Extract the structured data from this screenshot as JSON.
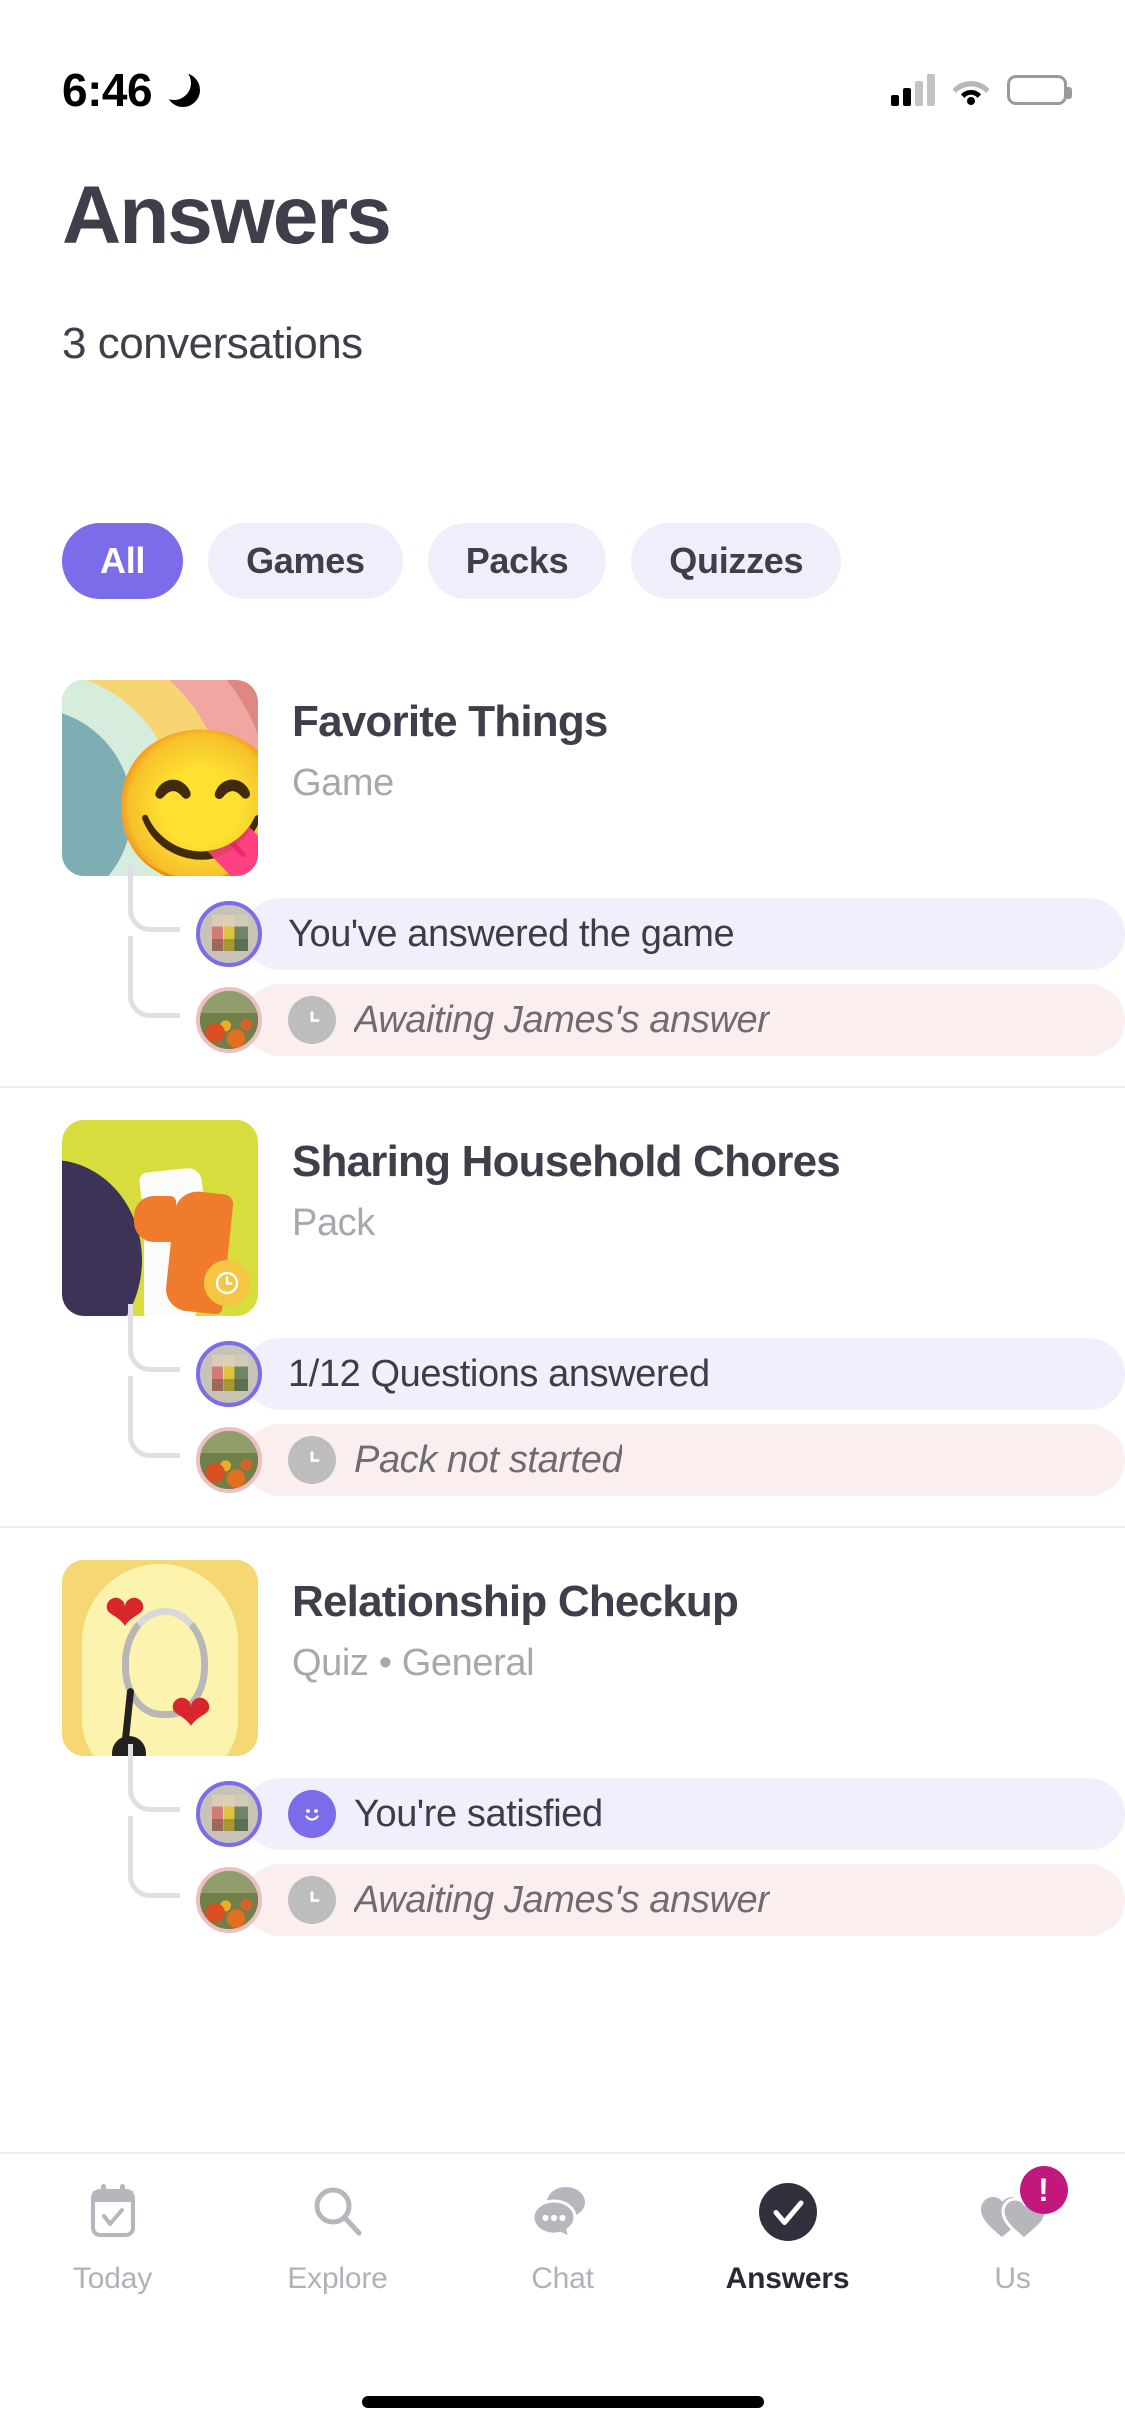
{
  "status_bar": {
    "time": "6:46",
    "dnd_icon": "moon-icon",
    "cellular_icon": "cellular-signal-icon",
    "wifi_icon": "wifi-icon",
    "battery_icon": "battery-icon"
  },
  "header": {
    "title": "Answers",
    "subtitle": "3 conversations"
  },
  "filters": {
    "chips": [
      {
        "label": "All",
        "active": true
      },
      {
        "label": "Games",
        "active": false
      },
      {
        "label": "Packs",
        "active": false
      },
      {
        "label": "Quizzes",
        "active": false
      }
    ]
  },
  "conversations": [
    {
      "title": "Favorite Things",
      "subtitle": "Game",
      "thumbnail": "rainbow-emoji-thumbnail",
      "emoji": "😋",
      "badge": null,
      "replies": [
        {
          "avatar": "your-avatar",
          "icon": null,
          "text": "You've answered the game",
          "state": "answered"
        },
        {
          "avatar": "partner-avatar",
          "icon": "clock-icon",
          "text": "Awaiting James's answer",
          "state": "waiting"
        }
      ]
    },
    {
      "title": "Sharing Household Chores",
      "subtitle": "Pack",
      "thumbnail": "cleaning-spray-thumbnail",
      "emoji": null,
      "badge": "clock-badge",
      "replies": [
        {
          "avatar": "your-avatar",
          "icon": null,
          "text": "1/12 Questions answered",
          "state": "answered"
        },
        {
          "avatar": "partner-avatar",
          "icon": "clock-icon",
          "text": "Pack not started",
          "state": "waiting"
        }
      ]
    },
    {
      "title": "Relationship Checkup",
      "subtitle": "Quiz • General",
      "thumbnail": "stethoscope-hearts-thumbnail",
      "emoji": null,
      "badge": null,
      "replies": [
        {
          "avatar": "your-avatar",
          "icon": "smiley-icon",
          "text": "You're satisfied",
          "state": "answered"
        },
        {
          "avatar": "partner-avatar",
          "icon": "clock-icon",
          "text": "Awaiting James's answer",
          "state": "waiting"
        }
      ]
    }
  ],
  "tabbar": {
    "items": [
      {
        "label": "Today",
        "icon": "calendar-check-icon",
        "active": false,
        "badge": null
      },
      {
        "label": "Explore",
        "icon": "search-icon",
        "active": false,
        "badge": null
      },
      {
        "label": "Chat",
        "icon": "chat-bubbles-icon",
        "active": false,
        "badge": null
      },
      {
        "label": "Answers",
        "icon": "check-circle-icon",
        "active": true,
        "badge": null
      },
      {
        "label": "Us",
        "icon": "two-hearts-icon",
        "active": false,
        "badge": "!"
      }
    ]
  },
  "colors": {
    "accent": "#7b6cea",
    "chip_inactive_bg": "#f0eefb",
    "answered_bubble": "#f1effc",
    "waiting_bubble": "#fbeeee",
    "text_primary": "#413d4b",
    "text_muted": "#a9a7ae",
    "badge": "#c2187e"
  }
}
